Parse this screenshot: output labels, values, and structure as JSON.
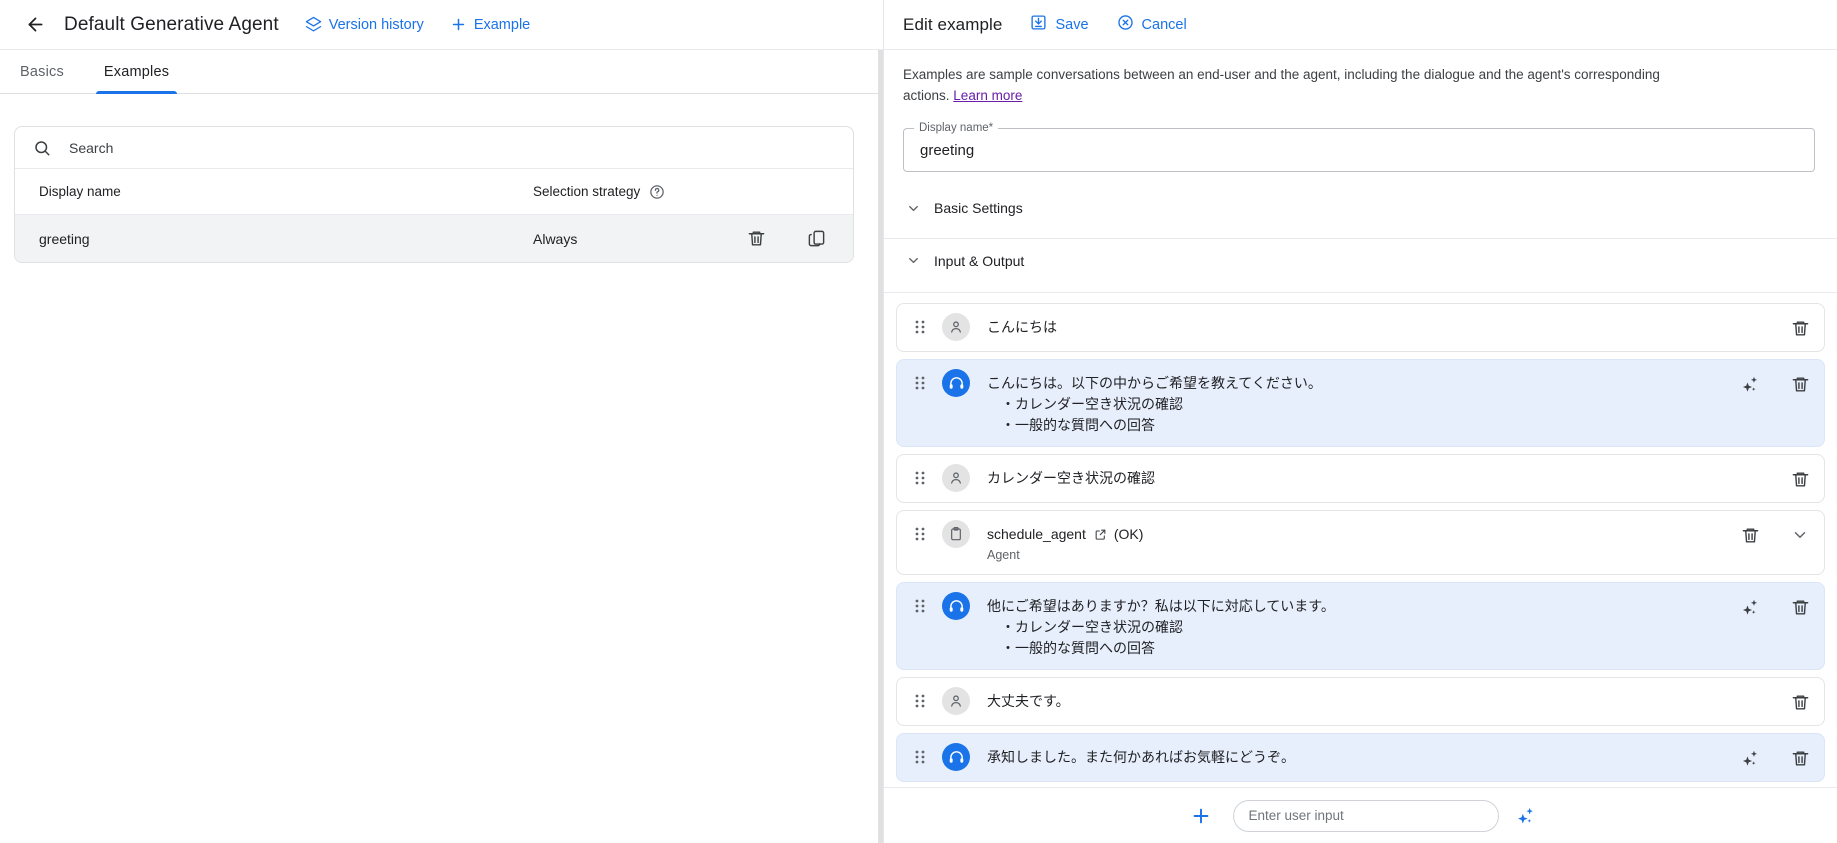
{
  "left": {
    "back_icon": "arrow-left-icon",
    "title": "Default Generative Agent",
    "version_history_label": "Version history",
    "version_history_icon": "layers-icon",
    "add_example_label": "Example",
    "add_example_icon": "plus-icon",
    "tabs": [
      {
        "label": "Basics",
        "active": false
      },
      {
        "label": "Examples",
        "active": true
      }
    ],
    "search": {
      "placeholder": "Search",
      "value": "",
      "icon": "search-icon"
    },
    "table": {
      "columns": [
        {
          "label": "Display name"
        },
        {
          "label": "Selection strategy",
          "help_icon": "help-circle-icon"
        }
      ],
      "rows": [
        {
          "display_name": "greeting",
          "selection_strategy": "Always",
          "delete_icon": "trash-icon",
          "copy_icon": "copy-icon"
        }
      ]
    }
  },
  "right": {
    "header": {
      "title": "Edit example",
      "save_label": "Save",
      "save_icon": "save-icon",
      "cancel_label": "Cancel",
      "cancel_icon": "cancel-circle-icon"
    },
    "description": "Examples are sample conversations between an end-user and the agent, including the dialogue and the agent's corresponding actions.",
    "learn_more_label": "Learn more",
    "display_name_field": {
      "label": "Display name*",
      "value": "greeting"
    },
    "sections": [
      {
        "label": "Basic Settings",
        "expanded": true,
        "chevron": "chevron-down-icon"
      },
      {
        "label": "Input & Output",
        "expanded": true,
        "chevron": "chevron-down-icon"
      }
    ],
    "conversation": [
      {
        "role": "user",
        "avatar_icon": "person-icon",
        "lines": [
          "こんにちは"
        ],
        "icons": [
          "trash-icon"
        ]
      },
      {
        "role": "agent",
        "avatar_icon": "headset-icon",
        "lines": [
          "こんにちは。以下の中からご希望を教えてください。",
          "・カレンダー空き状況の確認",
          "・一般的な質問への回答"
        ],
        "icons": [
          "sparkle-icon",
          "trash-icon"
        ]
      },
      {
        "role": "user",
        "avatar_icon": "person-icon",
        "lines": [
          "カレンダー空き状況の確認"
        ],
        "icons": [
          "trash-icon"
        ]
      },
      {
        "role": "tool",
        "avatar_icon": "clipboard-icon",
        "title": "schedule_agent",
        "title_icon": "external-link-icon",
        "status": "(OK)",
        "subtitle": "Agent",
        "icons": [
          "trash-icon",
          "chevron-down-icon"
        ]
      },
      {
        "role": "agent",
        "avatar_icon": "headset-icon",
        "lines": [
          "他にご希望はありますか？私は以下に対応しています。",
          "・カレンダー空き状況の確認",
          "・一般的な質問への回答"
        ],
        "icons": [
          "sparkle-icon",
          "trash-icon"
        ]
      },
      {
        "role": "user",
        "avatar_icon": "person-icon",
        "lines": [
          "大丈夫です。"
        ],
        "icons": [
          "trash-icon"
        ]
      },
      {
        "role": "agent",
        "avatar_icon": "headset-icon",
        "lines": [
          "承知しました。また何かあればお気軽にどうぞ。"
        ],
        "icons": [
          "sparkle-icon",
          "trash-icon"
        ]
      }
    ],
    "footer": {
      "add_icon": "plus-icon",
      "input_placeholder": "Enter user input",
      "input_value": "",
      "sparkle_icon": "sparkle-icon"
    }
  },
  "colors": {
    "accent": "#1a73e8",
    "agent_bubble": "#e8effc",
    "row_highlight": "#f1f3f4",
    "visited_link": "#681da8"
  }
}
